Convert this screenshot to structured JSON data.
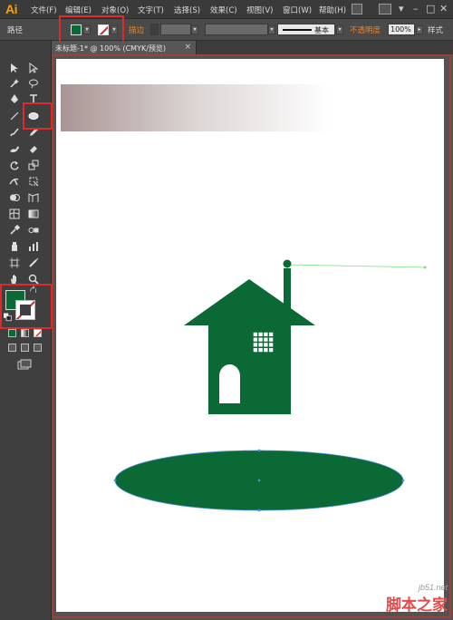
{
  "app": {
    "logo": "Ai"
  },
  "menu": {
    "items": [
      "文件(F)",
      "编辑(E)",
      "对象(O)",
      "文字(T)",
      "选择(S)",
      "效果(C)",
      "视图(V)",
      "窗口(W)",
      "帮助(H)"
    ]
  },
  "control_bar": {
    "object_type": "路径",
    "stroke_label": "描边",
    "stroke_style": "基本",
    "opacity_label": "不透明度",
    "opacity_value": "100%",
    "styles_label": "样式",
    "fill_color": "#0b6935",
    "stroke_color": "none"
  },
  "document": {
    "tab_title": "未标题-1* @ 100% (CMYK/预览)",
    "close": "×"
  },
  "artwork": {
    "house_color": "#0b6935",
    "ellipse_color": "#0b6935",
    "gradient": [
      "#a99593",
      "#ffffff"
    ]
  },
  "watermark": {
    "site": "jb51.net",
    "brand": "脚本之家"
  }
}
